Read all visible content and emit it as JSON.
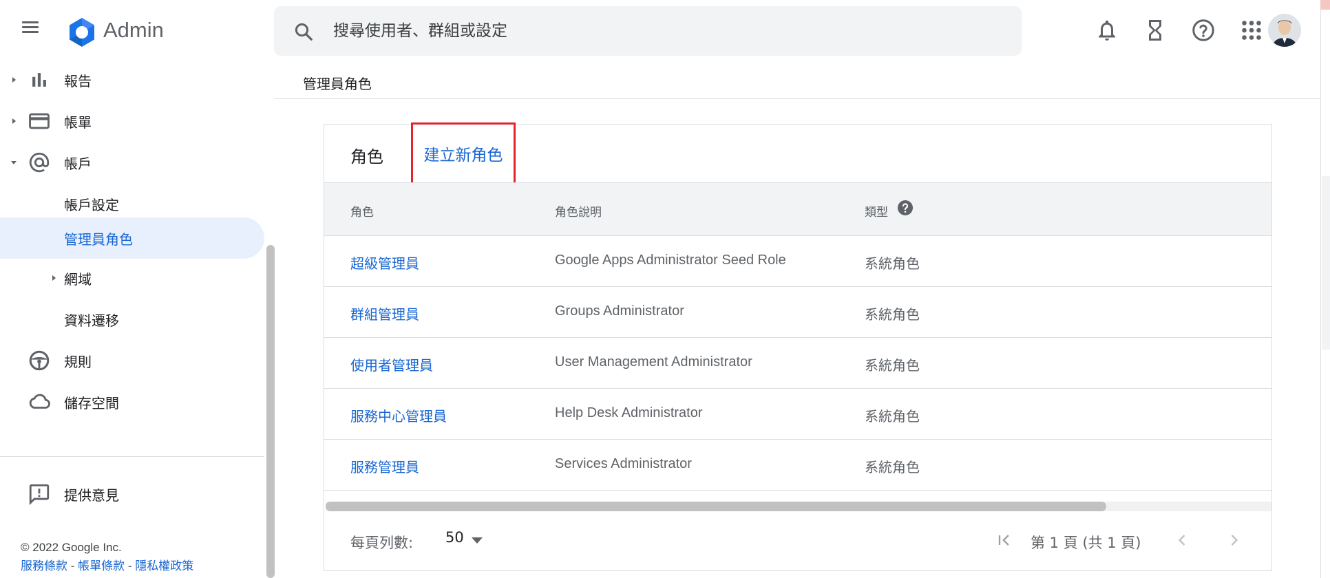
{
  "header": {
    "app_title": "Admin",
    "search_placeholder": "搜尋使用者、群組或設定",
    "icons": [
      "menu-icon",
      "search-icon",
      "bell-icon",
      "hourglass-icon",
      "help-icon",
      "apps-icon",
      "avatar"
    ]
  },
  "sidebar": {
    "items": [
      {
        "label": "報告",
        "icon": "bar-chart-icon",
        "expandable": true
      },
      {
        "label": "帳單",
        "icon": "credit-card-icon",
        "expandable": true
      },
      {
        "label": "帳戶",
        "icon": "at-icon",
        "expanded": true
      },
      {
        "label": "帳戶設定"
      },
      {
        "label": "管理員角色",
        "active": true
      },
      {
        "label": "網域",
        "expandable": true
      },
      {
        "label": "資料遷移"
      },
      {
        "label": "規則",
        "icon": "steering-icon"
      },
      {
        "label": "儲存空間",
        "icon": "cloud-icon"
      }
    ],
    "feedback_label": "提供意見",
    "footer": {
      "copyright": "© 2022 Google Inc.",
      "links": [
        "服務條款",
        "帳單條款",
        "隱私權政策"
      ],
      "separator": " - "
    }
  },
  "breadcrumb": "管理員角色",
  "roles_card": {
    "title": "角色",
    "create_button": "建立新角色",
    "columns": [
      "角色",
      "角色說明",
      "類型"
    ],
    "rows": [
      {
        "name": "超級管理員",
        "description": "Google Apps Administrator Seed Role",
        "type": "系統角色"
      },
      {
        "name": "群組管理員",
        "description": "Groups Administrator",
        "type": "系統角色"
      },
      {
        "name": "使用者管理員",
        "description": "User Management Administrator",
        "type": "系統角色"
      },
      {
        "name": "服務中心管理員",
        "description": "Help Desk Administrator",
        "type": "系統角色"
      },
      {
        "name": "服務管理員",
        "description": "Services Administrator",
        "type": "系統角色"
      }
    ],
    "pagination": {
      "rows_per_page_label": "每頁列數:",
      "rows_per_page": "50",
      "page_info": "第 1 頁 (共 1 頁)"
    }
  },
  "colors": {
    "accent": "#1967d2",
    "active_bg": "#e8f0fe",
    "highlight_box": "#e3242b"
  }
}
